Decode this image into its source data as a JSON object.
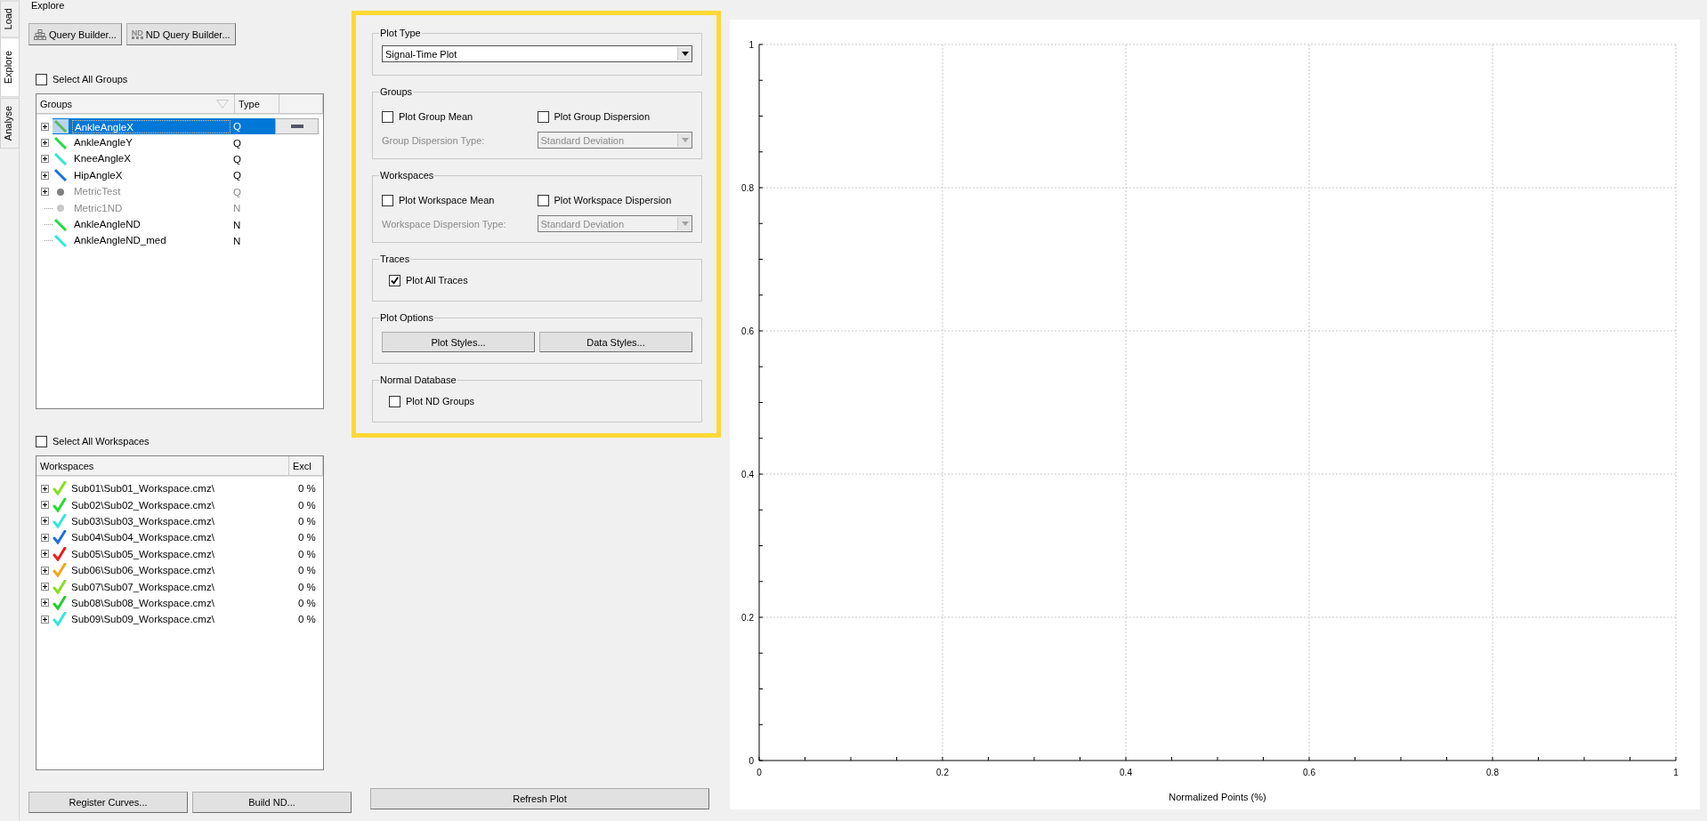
{
  "side_tabs": [
    {
      "label": "Load",
      "selected": false
    },
    {
      "label": "Explore",
      "selected": true
    },
    {
      "label": "Analyse",
      "selected": false
    }
  ],
  "page_title": "Explore",
  "toolbar": [
    {
      "kind": "query",
      "label": "Query Builder..."
    },
    {
      "kind": "nd",
      "label": "ND Query Builder...",
      "icon_text": "ND"
    }
  ],
  "select_all_groups": {
    "label": "Select All Groups",
    "checked": false
  },
  "groups_table": {
    "columns": [
      "Groups",
      "Type"
    ],
    "rows": [
      {
        "name": "AnkleAngleX",
        "type": "Q",
        "kind": "line",
        "color": "#5cb85c",
        "selected": true,
        "disabled": false,
        "expandable": true
      },
      {
        "name": "AnkleAngleY",
        "type": "Q",
        "kind": "line",
        "color": "#22dd44",
        "selected": false,
        "disabled": false,
        "expandable": true
      },
      {
        "name": "KneeAngleX",
        "type": "Q",
        "kind": "line",
        "color": "#33e6cc",
        "selected": false,
        "disabled": false,
        "expandable": true
      },
      {
        "name": "HipAngleX",
        "type": "Q",
        "kind": "line",
        "color": "#1e6fe0",
        "selected": false,
        "disabled": false,
        "expandable": true
      },
      {
        "name": "MetricTest",
        "type": "Q",
        "kind": "dot",
        "color": "#808080",
        "selected": false,
        "disabled": true,
        "expandable": true
      },
      {
        "name": "Metric1ND",
        "type": "N",
        "kind": "dot",
        "color": "#c8c8c8",
        "selected": false,
        "disabled": true,
        "expandable": false
      },
      {
        "name": "AnkleAngleND",
        "type": "N",
        "kind": "line",
        "color": "#22dd44",
        "selected": false,
        "disabled": false,
        "expandable": false
      },
      {
        "name": "AnkleAngleND_med",
        "type": "N",
        "kind": "line",
        "color": "#33e6dd",
        "selected": false,
        "disabled": false,
        "expandable": false
      }
    ]
  },
  "select_all_workspaces": {
    "label": "Select All Workspaces",
    "checked": false
  },
  "workspaces_table": {
    "columns": [
      "Workspaces",
      "Excl"
    ],
    "rows": [
      {
        "name": "Sub01\\Sub01_Workspace.cmz\\",
        "excl": "0 %",
        "color": "#88dd22"
      },
      {
        "name": "Sub02\\Sub02_Workspace.cmz\\",
        "excl": "0 %",
        "color": "#22dd33"
      },
      {
        "name": "Sub03\\Sub03_Workspace.cmz\\",
        "excl": "0 %",
        "color": "#33e6dd"
      },
      {
        "name": "Sub04\\Sub04_Workspace.cmz\\",
        "excl": "0 %",
        "color": "#1e6fe0"
      },
      {
        "name": "Sub05\\Sub05_Workspace.cmz\\",
        "excl": "0 %",
        "color": "#ee1c1c"
      },
      {
        "name": "Sub06\\Sub06_Workspace.cmz\\",
        "excl": "0 %",
        "color": "#f0a818"
      },
      {
        "name": "Sub07\\Sub07_Workspace.cmz\\",
        "excl": "0 %",
        "color": "#88dd22"
      },
      {
        "name": "Sub08\\Sub08_Workspace.cmz\\",
        "excl": "0 %",
        "color": "#22cc33"
      },
      {
        "name": "Sub09\\Sub09_Workspace.cmz\\",
        "excl": "0 %",
        "color": "#33e6dd"
      }
    ]
  },
  "bottom_buttons": [
    "Register Curves...",
    "Build ND..."
  ],
  "options": {
    "plot_type": {
      "title": "Plot Type",
      "value": "Signal-Time Plot"
    },
    "groups": {
      "title": "Groups",
      "mean": {
        "label": "Plot Group Mean",
        "checked": false
      },
      "dispersion": {
        "label": "Plot Group Dispersion",
        "checked": false
      },
      "dispersion_type": {
        "label": "Group Dispersion Type:",
        "value": "Standard Deviation",
        "disabled": true
      }
    },
    "workspaces": {
      "title": "Workspaces",
      "mean": {
        "label": "Plot Workspace Mean",
        "checked": false
      },
      "dispersion": {
        "label": "Plot Workspace Dispersion",
        "checked": false
      },
      "dispersion_type": {
        "label": "Workspace Dispersion Type:",
        "value": "Standard Deviation",
        "disabled": true
      }
    },
    "traces": {
      "title": "Traces",
      "plot_all": {
        "label": "Plot All Traces",
        "checked": true
      }
    },
    "plot_options": {
      "title": "Plot Options",
      "buttons": [
        "Plot Styles...",
        "Data Styles..."
      ]
    },
    "normal_database": {
      "title": "Normal Database",
      "plot_nd": {
        "label": "Plot ND Groups",
        "checked": false
      }
    }
  },
  "refresh_button": "Refresh Plot",
  "plot": {
    "chart_data": {
      "type": "line",
      "grid": true,
      "xlabel": "Normalized Points (%)",
      "xlim": [
        0,
        1
      ],
      "ylim": [
        0,
        1
      ],
      "xticks": [
        0,
        0.2,
        0.4,
        0.6,
        0.8,
        1
      ],
      "yticks": [
        0,
        0.2,
        0.4,
        0.6,
        0.8,
        1
      ]
    }
  }
}
